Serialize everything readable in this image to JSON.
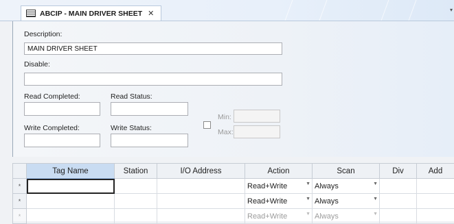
{
  "tab": {
    "title": "ABCIP - MAIN DRIVER SHEET",
    "close_glyph": "✕",
    "icon": "driver-sheet-icon",
    "menu_glyph": "▾"
  },
  "form": {
    "description_label": "Description:",
    "description_value": "MAIN DRIVER SHEET",
    "disable_label": "Disable:",
    "disable_value": "",
    "read_completed_label": "Read Completed:",
    "read_completed_value": "",
    "read_status_label": "Read Status:",
    "read_status_value": "",
    "write_completed_label": "Write Completed:",
    "write_completed_value": "",
    "write_status_label": "Write Status:",
    "write_status_value": "",
    "min_label": "Min:",
    "min_value": "",
    "max_label": "Max:",
    "max_value": "",
    "minmax_checked": false
  },
  "grid": {
    "columns": [
      "Tag Name",
      "Station",
      "I/O Address",
      "Action",
      "Scan",
      "Div",
      "Add"
    ],
    "rows": [
      {
        "marker": "*",
        "tag_name": "",
        "station": "",
        "io_address": "",
        "action": "Read+Write",
        "scan": "Always",
        "div": "",
        "add": ""
      },
      {
        "marker": "*",
        "tag_name": "",
        "station": "",
        "io_address": "",
        "action": "Read+Write",
        "scan": "Always",
        "div": "",
        "add": ""
      },
      {
        "marker": "*",
        "tag_name": "",
        "station": "",
        "io_address": "",
        "action": "Read+Write",
        "scan": "Always",
        "div": "",
        "add": ""
      }
    ]
  },
  "colors": {
    "accent": "#c9dcf2",
    "tab_border": "#b9c9dc"
  }
}
